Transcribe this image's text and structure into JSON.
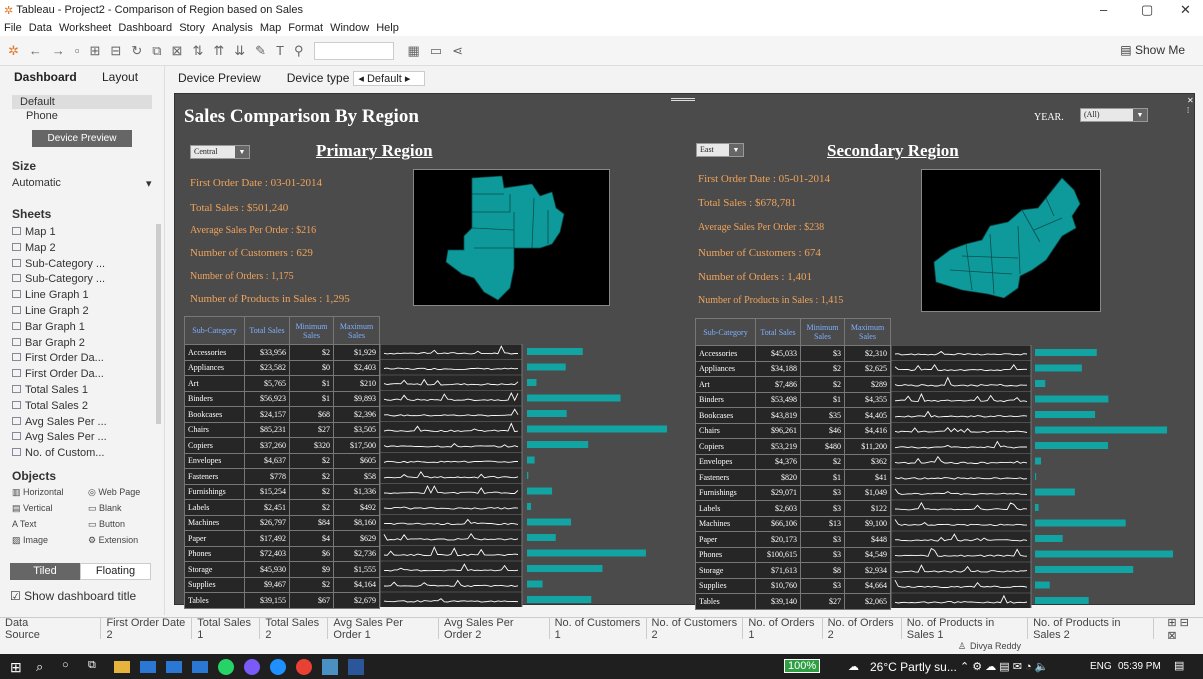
{
  "window": {
    "title": "Tableau - Project2 - Comparison of Region based on Sales"
  },
  "menu": [
    "File",
    "Data",
    "Worksheet",
    "Dashboard",
    "Story",
    "Analysis",
    "Map",
    "Format",
    "Window",
    "Help"
  ],
  "toolbar": {
    "show_me": "Show Me"
  },
  "left_pane": {
    "tabs": [
      "Dashboard",
      "Layout"
    ],
    "devices": [
      "Default",
      "Phone"
    ],
    "device_preview_button": "Device Preview",
    "size_title": "Size",
    "size_value": "Automatic",
    "sheets_title": "Sheets",
    "sheets": [
      "Map 1",
      "Map 2",
      "Sub-Category ...",
      "Sub-Category ...",
      "Line Graph 1",
      "Line Graph 2",
      "Bar Graph 1",
      "Bar Graph 2",
      "First Order Da...",
      "First Order Da...",
      "Total Sales 1",
      "Total Sales 2",
      "Avg Sales Per ...",
      "Avg Sales Per ...",
      "No. of Custom..."
    ],
    "objects_title": "Objects",
    "objects": [
      "Horizontal",
      "Web Page",
      "Vertical",
      "Blank",
      "Text",
      "Button",
      "Image",
      "Extension"
    ],
    "tiled": "Tiled",
    "floating": "Floating",
    "show_title": "Show dashboard title"
  },
  "device_bar": {
    "preview": "Device Preview",
    "type_label": "Device type",
    "type_value": "Default"
  },
  "dashboard": {
    "title": "Sales Comparison By Region",
    "year_label": "YEAR.",
    "year_value": "(All)",
    "columns": [
      "Sub-Category",
      "Total Sales",
      "Minimum Sales",
      "Maximum Sales"
    ],
    "primary": {
      "title": "Primary Region",
      "region": "Central",
      "stats": [
        "First Order Date  : 03-01-2014",
        "Total Sales  : $501,240",
        "Average Sales Per Order : $216",
        "Number of Customers : 629",
        "Number of Orders : 1,175",
        "Number of Products in Sales :  1,295"
      ],
      "rows": [
        [
          "Accessories",
          "$33,956",
          "$2",
          "$1,929"
        ],
        [
          "Appliances",
          "$23,582",
          "$0",
          "$2,403"
        ],
        [
          "Art",
          "$5,765",
          "$1",
          "$210"
        ],
        [
          "Binders",
          "$56,923",
          "$1",
          "$9,893"
        ],
        [
          "Bookcases",
          "$24,157",
          "$68",
          "$2,396"
        ],
        [
          "Chairs",
          "$85,231",
          "$27",
          "$3,505"
        ],
        [
          "Copiers",
          "$37,260",
          "$320",
          "$17,500"
        ],
        [
          "Envelopes",
          "$4,637",
          "$2",
          "$605"
        ],
        [
          "Fasteners",
          "$778",
          "$2",
          "$58"
        ],
        [
          "Furnishings",
          "$15,254",
          "$2",
          "$1,336"
        ],
        [
          "Labels",
          "$2,451",
          "$2",
          "$492"
        ],
        [
          "Machines",
          "$26,797",
          "$84",
          "$8,160"
        ],
        [
          "Paper",
          "$17,492",
          "$4",
          "$629"
        ],
        [
          "Phones",
          "$72,403",
          "$6",
          "$2,736"
        ],
        [
          "Storage",
          "$45,930",
          "$9",
          "$1,555"
        ],
        [
          "Supplies",
          "$9,467",
          "$2",
          "$4,164"
        ],
        [
          "Tables",
          "$39,155",
          "$67",
          "$2,679"
        ]
      ]
    },
    "secondary": {
      "title": "Secondary Region",
      "region": "East",
      "stats": [
        "First Order Date  :  05-01-2014",
        "Total Sales  :  $678,781",
        "Average Sales Per Order : $238",
        "Number of Customers : 674",
        "Number of Orders : 1,401",
        "Number of Products in Sales : 1,415"
      ],
      "rows": [
        [
          "Accessories",
          "$45,033",
          "$3",
          "$2,310"
        ],
        [
          "Appliances",
          "$34,188",
          "$2",
          "$2,625"
        ],
        [
          "Art",
          "$7,486",
          "$2",
          "$289"
        ],
        [
          "Binders",
          "$53,498",
          "$1",
          "$4,355"
        ],
        [
          "Bookcases",
          "$43,819",
          "$35",
          "$4,405"
        ],
        [
          "Chairs",
          "$96,261",
          "$46",
          "$4,416"
        ],
        [
          "Copiers",
          "$53,219",
          "$480",
          "$11,200"
        ],
        [
          "Envelopes",
          "$4,376",
          "$2",
          "$362"
        ],
        [
          "Fasteners",
          "$820",
          "$1",
          "$41"
        ],
        [
          "Furnishings",
          "$29,071",
          "$3",
          "$1,049"
        ],
        [
          "Labels",
          "$2,603",
          "$3",
          "$122"
        ],
        [
          "Machines",
          "$66,106",
          "$13",
          "$9,100"
        ],
        [
          "Paper",
          "$20,173",
          "$3",
          "$448"
        ],
        [
          "Phones",
          "$100,615",
          "$3",
          "$4,549"
        ],
        [
          "Storage",
          "$71,613",
          "$8",
          "$2,934"
        ],
        [
          "Supplies",
          "$10,760",
          "$3",
          "$4,664"
        ],
        [
          "Tables",
          "$39,140",
          "$27",
          "$2,065"
        ]
      ]
    }
  },
  "chart_data": [
    {
      "type": "bar",
      "categories": [
        "Accessories",
        "Appliances",
        "Art",
        "Binders",
        "Bookcases",
        "Chairs",
        "Copiers",
        "Envelopes",
        "Fasteners",
        "Furnishings",
        "Labels",
        "Machines",
        "Paper",
        "Phones",
        "Storage",
        "Supplies",
        "Tables"
      ],
      "values": [
        33956,
        23582,
        5765,
        56923,
        24157,
        85231,
        37260,
        4637,
        778,
        15254,
        2451,
        26797,
        17492,
        72403,
        45930,
        9467,
        39155
      ]
    },
    {
      "type": "bar",
      "categories": [
        "Accessories",
        "Appliances",
        "Art",
        "Binders",
        "Bookcases",
        "Chairs",
        "Copiers",
        "Envelopes",
        "Fasteners",
        "Furnishings",
        "Labels",
        "Machines",
        "Paper",
        "Phones",
        "Storage",
        "Supplies",
        "Tables"
      ],
      "values": [
        45033,
        34188,
        7486,
        53498,
        43819,
        96261,
        53219,
        4376,
        820,
        29071,
        2603,
        66106,
        20173,
        100615,
        71613,
        10760,
        39140
      ]
    }
  ],
  "bottom_tabs": [
    "Data Source",
    "First Order Date 2",
    "Total Sales 1",
    "Total Sales 2",
    "Avg Sales Per Order 1",
    "Avg Sales Per Order 2",
    "No. of Customers 1",
    "No. of Customers 2",
    "No. of Orders 1",
    "No. of Orders 2",
    "No. of Products in Sales 1",
    "No. of Products in Sales 2"
  ],
  "status": {
    "user": "Divya Reddy"
  },
  "taskbar": {
    "battery": "100%",
    "weather": "26°C  Partly su...",
    "lang": "ENG",
    "time": "05:39 PM"
  },
  "colors": {
    "dashboard_bg": "#4b4b4b",
    "accent": "#12a3a3",
    "stat_text": "#f0a35b"
  }
}
